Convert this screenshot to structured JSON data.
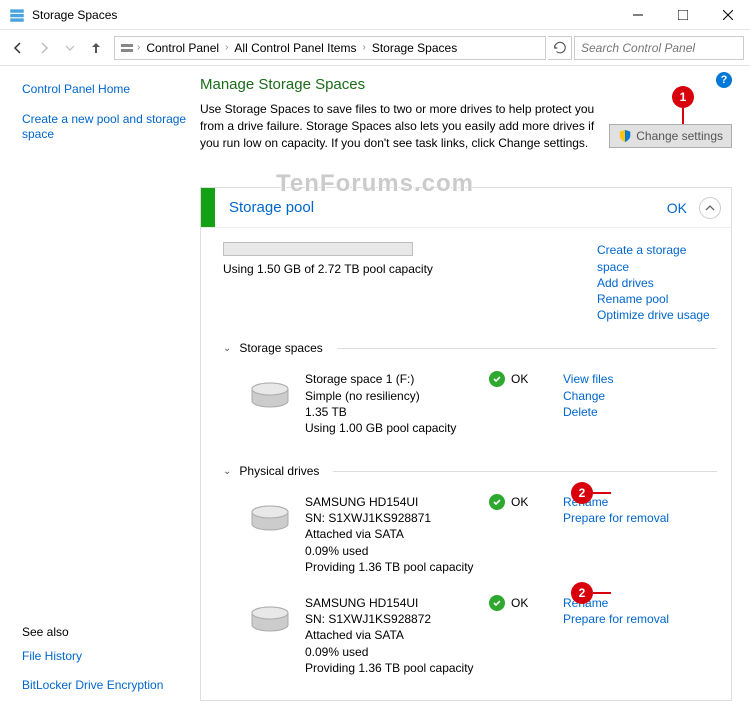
{
  "titlebar": {
    "title": "Storage Spaces"
  },
  "breadcrumb": {
    "items": [
      "Control Panel",
      "All Control Panel Items",
      "Storage Spaces"
    ]
  },
  "search": {
    "placeholder": "Search Control Panel"
  },
  "sidebar": {
    "home": "Control Panel Home",
    "create": "Create a new pool and storage space",
    "seealso_label": "See also",
    "seealso": [
      "File History",
      "BitLocker Drive Encryption"
    ]
  },
  "main": {
    "heading": "Manage Storage Spaces",
    "description": "Use Storage Spaces to save files to two or more drives to help protect you from a drive failure. Storage Spaces also lets you easily add more drives if you run low on capacity. If you don't see task links, click Change settings.",
    "change_settings": "Change settings"
  },
  "pool": {
    "name": "Storage pool",
    "status": "OK",
    "usage": "Using 1.50 GB of 2.72 TB pool capacity",
    "links": [
      "Create a storage space",
      "Add drives",
      "Rename pool",
      "Optimize drive usage"
    ]
  },
  "sections": {
    "spaces_label": "Storage spaces",
    "drives_label": "Physical drives"
  },
  "space": {
    "name": "Storage space 1 (F:)",
    "type": "Simple (no resiliency)",
    "size": "1.35 TB",
    "usage": "Using 1.00 GB pool capacity",
    "status": "OK",
    "actions": [
      "View files",
      "Change",
      "Delete"
    ]
  },
  "drives": [
    {
      "name": "SAMSUNG HD154UI",
      "sn": "SN: S1XWJ1KS928871",
      "attach": "Attached via SATA",
      "used": "0.09% used",
      "providing": "Providing 1.36 TB pool capacity",
      "status": "OK",
      "actions": [
        "Rename",
        "Prepare for removal"
      ]
    },
    {
      "name": "SAMSUNG HD154UI",
      "sn": "SN: S1XWJ1KS928872",
      "attach": "Attached via SATA",
      "used": "0.09% used",
      "providing": "Providing 1.36 TB pool capacity",
      "status": "OK",
      "actions": [
        "Rename",
        "Prepare for removal"
      ]
    }
  ],
  "annotations": {
    "one": "1",
    "two": "2"
  },
  "watermark": "TenForums.com"
}
